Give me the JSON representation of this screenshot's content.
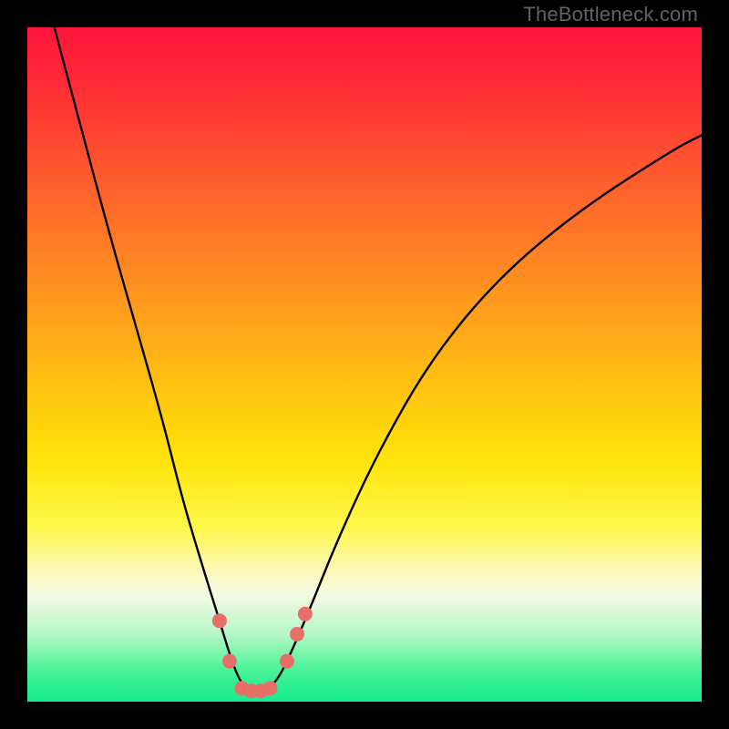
{
  "watermark": "TheBottleneck.com",
  "chart_data": {
    "type": "line",
    "title": "",
    "xlabel": "",
    "ylabel": "",
    "xlim": [
      0,
      100
    ],
    "ylim": [
      0,
      100
    ],
    "series": [
      {
        "name": "bottleneck-curve",
        "x": [
          4,
          8,
          12,
          16,
          20,
          23,
          26,
          28.5,
          30,
          31.5,
          33,
          35,
          37,
          39,
          42,
          46,
          52,
          60,
          70,
          82,
          96,
          100
        ],
        "y": [
          100,
          85,
          70,
          56,
          42,
          30,
          20,
          12,
          7,
          3,
          1.5,
          1.5,
          3,
          7,
          14,
          24,
          37,
          51,
          63,
          73,
          82,
          84
        ]
      }
    ],
    "markers": [
      {
        "name": "dot-left-up",
        "x": 28.5,
        "y": 12
      },
      {
        "name": "dot-left-low",
        "x": 30,
        "y": 6
      },
      {
        "name": "dot-bottom-1",
        "x": 31.8,
        "y": 2
      },
      {
        "name": "dot-bottom-2",
        "x": 33.2,
        "y": 1.6
      },
      {
        "name": "dot-bottom-3",
        "x": 34.6,
        "y": 1.6
      },
      {
        "name": "dot-bottom-4",
        "x": 36,
        "y": 2
      },
      {
        "name": "dot-right-low",
        "x": 38.5,
        "y": 6
      },
      {
        "name": "dot-right-up1",
        "x": 40,
        "y": 10
      },
      {
        "name": "dot-right-up2",
        "x": 41.2,
        "y": 13
      }
    ],
    "marker_color": "#e76f6a",
    "curve_color": "#000000"
  }
}
